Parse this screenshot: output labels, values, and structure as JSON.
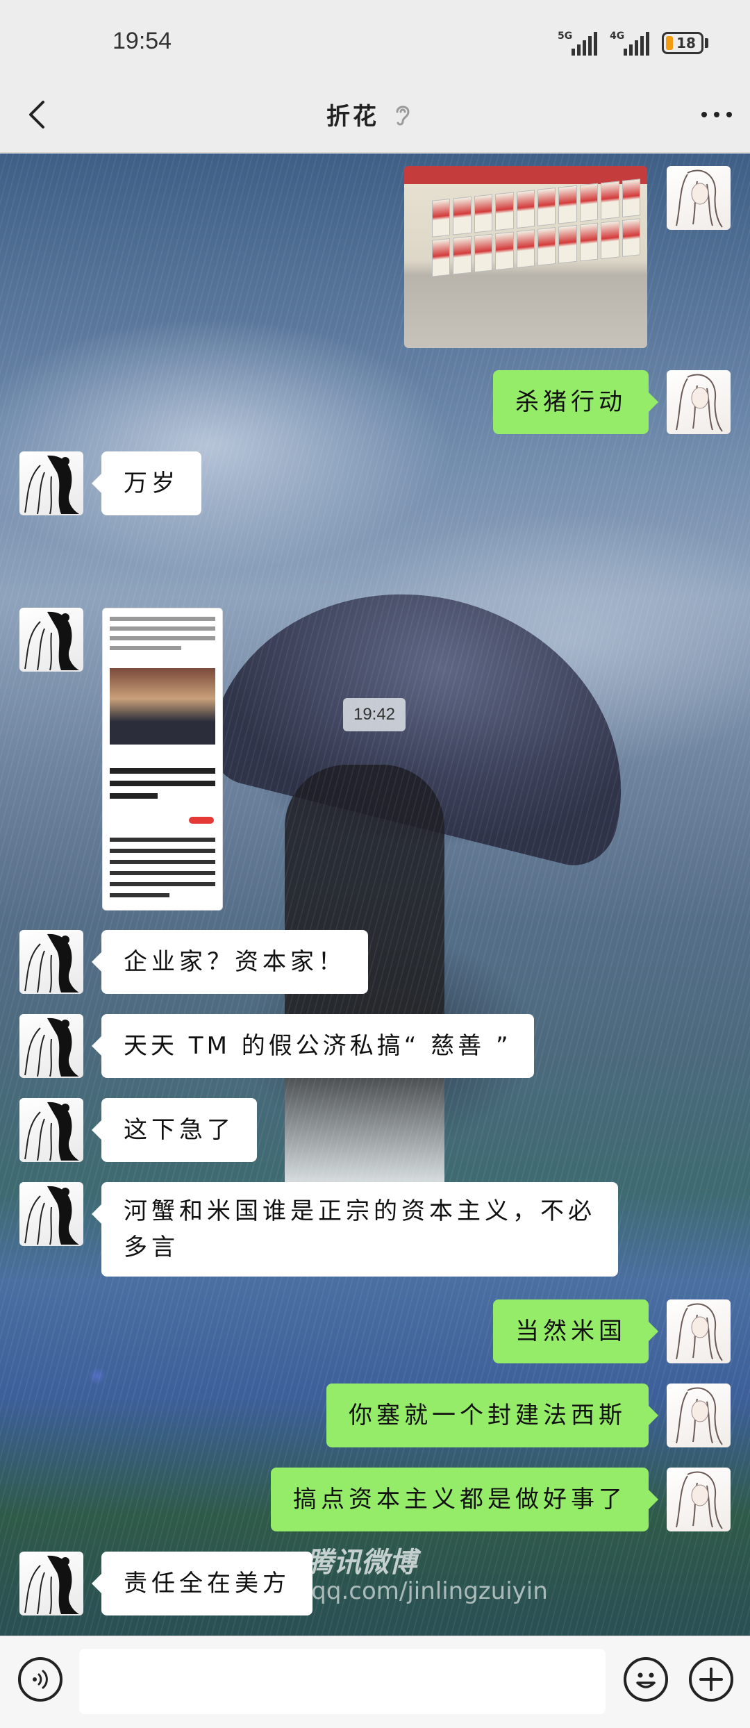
{
  "status_bar": {
    "time": "19:54",
    "net1": "5G",
    "net2": "4G",
    "battery": "18",
    "battery_color": "#f39c12"
  },
  "nav": {
    "title": "折花",
    "back_icon": "chevron-left-icon",
    "ear_icon": "ear-icon",
    "more_icon": "more-icon"
  },
  "colors": {
    "self_bubble": "#95ec69",
    "other_bubble": "#ffffff",
    "header_bg": "#ededed"
  },
  "messages": [
    {
      "sender": "self",
      "kind": "image",
      "desc_icon": "photo-thumbnail"
    },
    {
      "sender": "self",
      "kind": "text",
      "text": "杀猪行动"
    },
    {
      "sender": "other",
      "kind": "text",
      "text": "万岁"
    },
    {
      "sender": "system",
      "kind": "time",
      "text": "19:42"
    },
    {
      "sender": "other",
      "kind": "image",
      "desc_icon": "screenshot-thumbnail"
    },
    {
      "sender": "other",
      "kind": "text",
      "text": "企业家？资本家！"
    },
    {
      "sender": "other",
      "kind": "text",
      "text": "天天 TM 的假公济私搞“ 慈善 ”"
    },
    {
      "sender": "other",
      "kind": "text",
      "text": "这下急了"
    },
    {
      "sender": "other",
      "kind": "text",
      "text": "河蟹和米国谁是正宗的资本主义，不必多言"
    },
    {
      "sender": "self",
      "kind": "text",
      "text": "当然米国"
    },
    {
      "sender": "self",
      "kind": "text",
      "text": "你塞就一个封建法西斯"
    },
    {
      "sender": "self",
      "kind": "text",
      "text": "搞点资本主义都是做好事了"
    },
    {
      "sender": "other",
      "kind": "text",
      "text": "责任全在美方"
    }
  ],
  "watermark": {
    "brand": "腾讯微博",
    "url": "http://t.qq.com/jinlingzuiyin"
  },
  "input_bar": {
    "placeholder": "",
    "voice_icon": "voice-icon",
    "emoji_icon": "emoji-icon",
    "plus_icon": "plus-icon"
  }
}
